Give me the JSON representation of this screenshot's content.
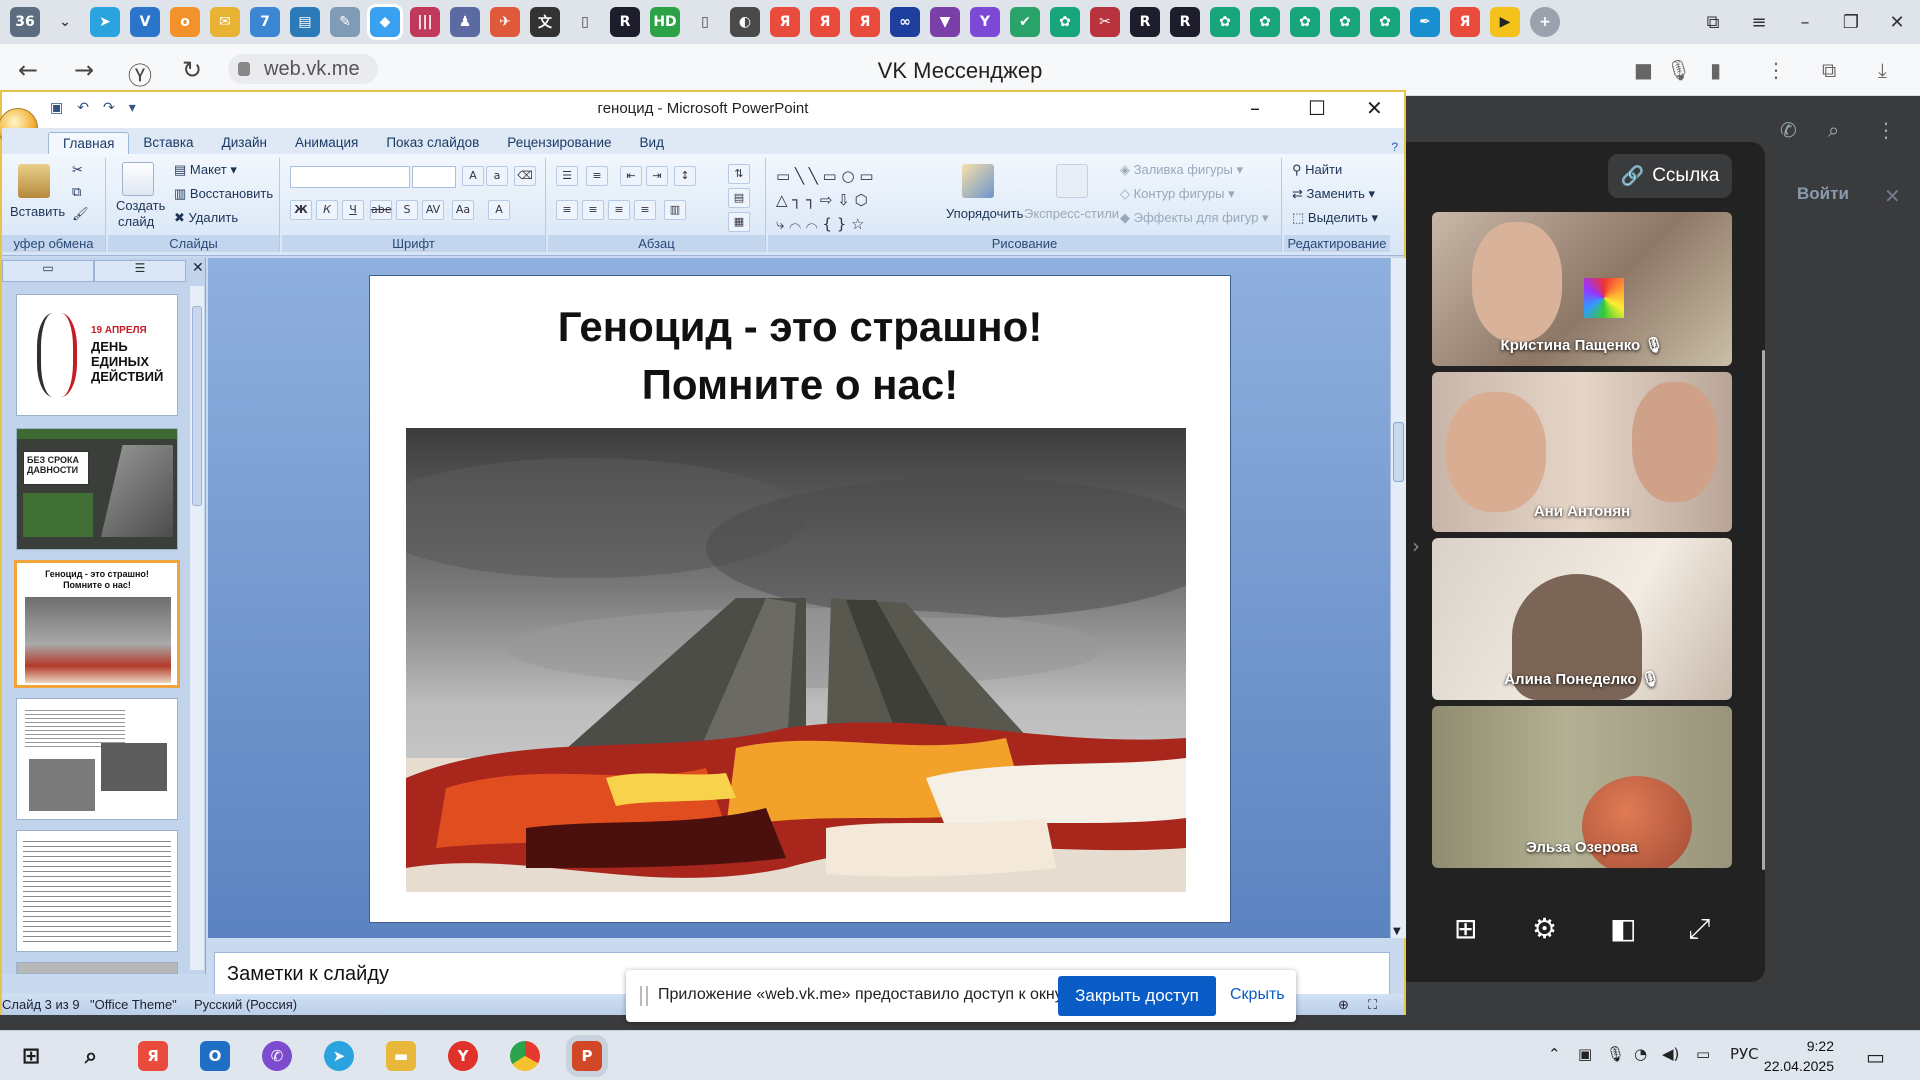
{
  "browser": {
    "url": "web.vk.me",
    "page_title": "VK Мессенджер",
    "tab_badge": "36"
  },
  "powerpoint": {
    "window_title": "геноцид - Microsoft PowerPoint",
    "ribbon_tabs": [
      "Главная",
      "Вставка",
      "Дизайн",
      "Анимация",
      "Показ слайдов",
      "Рецензирование",
      "Вид"
    ],
    "groups": {
      "clipboard": {
        "label": "уфер обмена",
        "paste": "Вставить"
      },
      "slides": {
        "label": "Слайды",
        "new_slide_1": "Создать",
        "new_slide_2": "слайд",
        "layout": "Макет",
        "reset": "Восстановить",
        "delete": "Удалить"
      },
      "font": {
        "label": "Шрифт"
      },
      "paragraph": {
        "label": "Абзац"
      },
      "drawing": {
        "label": "Рисование",
        "arrange": "Упорядочить",
        "quick_styles": "Экспресс-стили",
        "fill": "Заливка фигуры",
        "outline": "Контур фигуры",
        "effects": "Эффекты для фигур"
      },
      "editing": {
        "label": "Редактирование",
        "find": "Найти",
        "replace": "Заменить",
        "select": "Выделить"
      }
    },
    "slide": {
      "title_line1": "Геноцид - это страшно!",
      "title_line2": "Помните о нас!"
    },
    "thumbnails": {
      "t1_date": "19 АПРЕЛЯ",
      "t1_line1": "ДЕНЬ",
      "t1_line2": "ЕДИНЫХ",
      "t1_line3": "ДЕЙСТВИЙ",
      "t2_title": "БЕЗ СРОКА ДАВНОСТИ",
      "t3_line1": "Геноцид - это страшно!",
      "t3_line2": "Помните о нас!"
    },
    "notes_placeholder": "Заметки к слайду",
    "status": {
      "slide_counter": "Слайд 3 из 9",
      "theme": "\"Office Theme\"",
      "language": "Русский (Россия)"
    }
  },
  "vk_call": {
    "link_button": "Ссылка",
    "login": "Войти",
    "participants": [
      {
        "name": "Кристина Пащенко",
        "muted": true
      },
      {
        "name": "Ани Антонян",
        "muted": false
      },
      {
        "name": "Алина Понеделко",
        "muted": true
      },
      {
        "name": "Эльза Озерова",
        "muted": false
      }
    ]
  },
  "share_banner": {
    "text": "Приложение «web.vk.me» предоставило доступ к окну.",
    "stop_button": "Закрыть доступ",
    "hide_link": "Скрыть"
  },
  "taskbar": {
    "language": "РУС",
    "time": "9:22",
    "date": "22.04.2025"
  },
  "colors": {
    "ppt_accent": "#e6c44b",
    "share_button": "#0a5cc7",
    "vk_panel": "#222223"
  }
}
